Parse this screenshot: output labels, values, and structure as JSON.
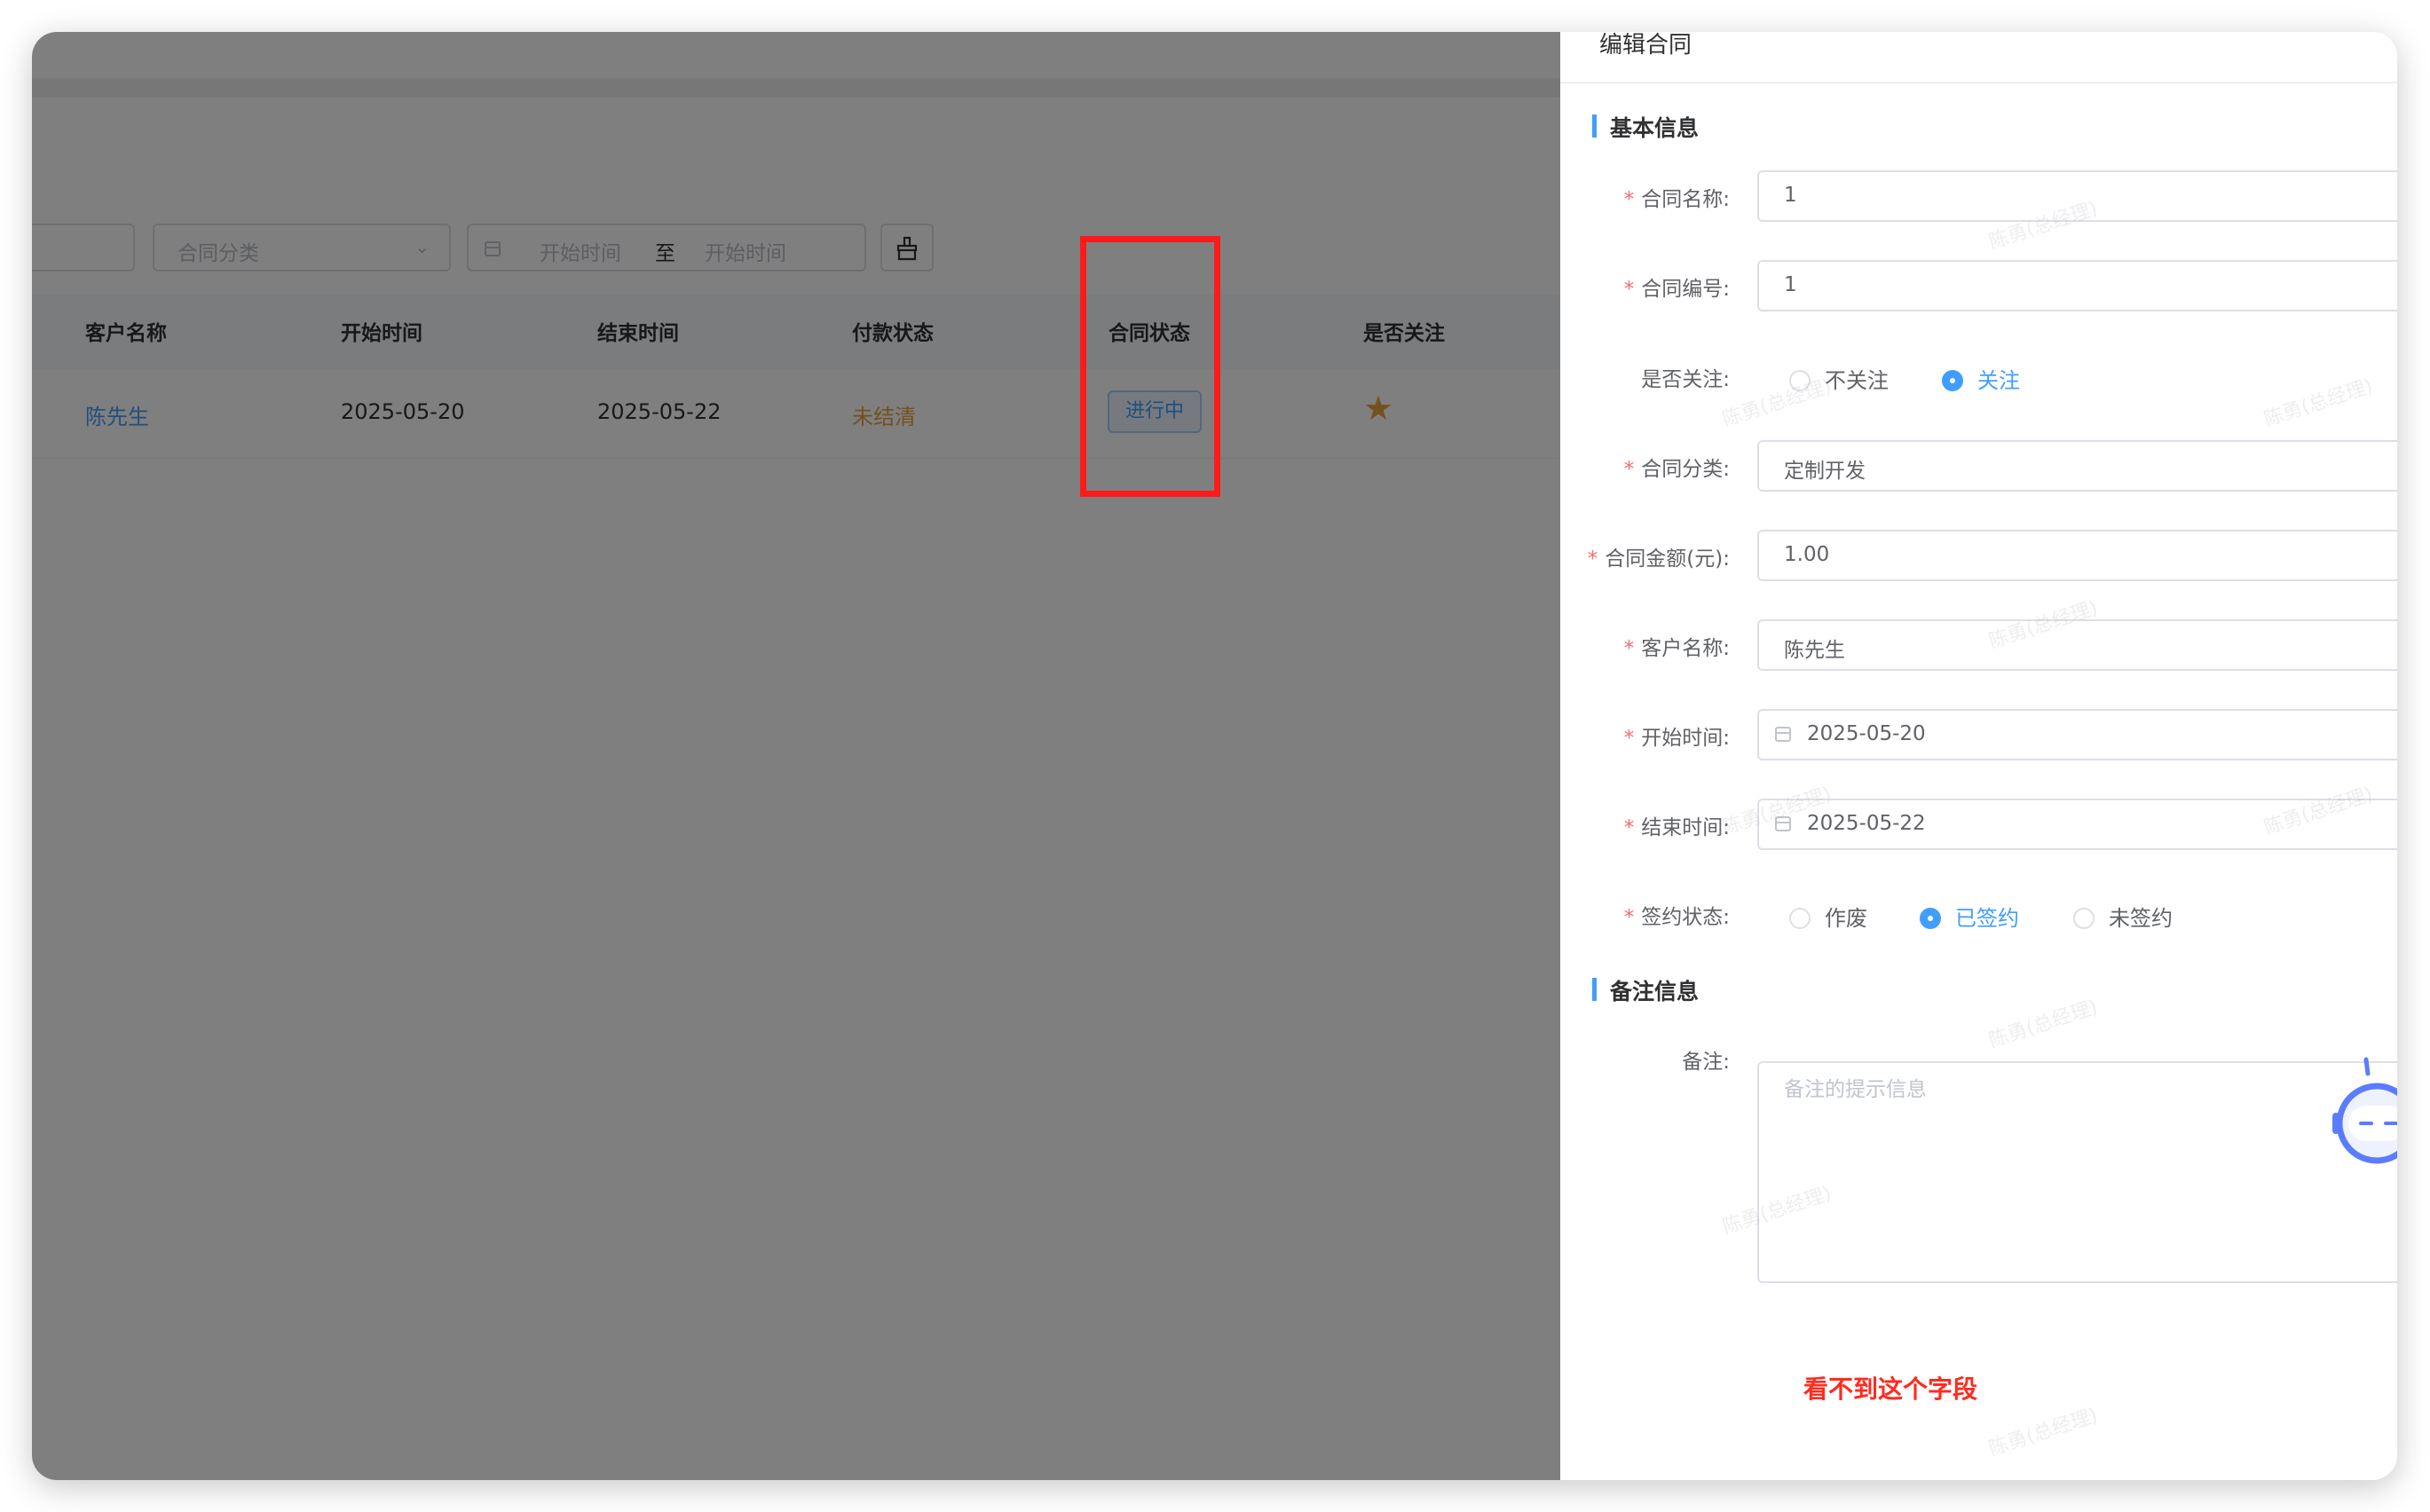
{
  "filters": {
    "category_placeholder": "合同分类",
    "start_placeholder": "开始时间",
    "range_separator": "至",
    "end_placeholder": "开始时间"
  },
  "table": {
    "columns": [
      "客户名称",
      "开始时间",
      "结束时间",
      "付款状态",
      "合同状态",
      "是否关注"
    ],
    "row": {
      "customer": "陈先生",
      "start": "2025-05-20",
      "end": "2025-05-22",
      "payment": "未结清",
      "status": "进行中",
      "followed": "★"
    }
  },
  "drawer": {
    "title": "编辑合同",
    "section_basic": "基本信息",
    "section_remark": "备注信息",
    "fields": {
      "name_label": "合同名称:",
      "name_value": "1",
      "number_label": "合同编号:",
      "number_value": "1",
      "follow_label": "是否关注:",
      "follow_options": [
        "不关注",
        "关注"
      ],
      "category_label": "合同分类:",
      "category_value": "定制开发",
      "amount_label": "合同金额(元):",
      "amount_value": "1.00",
      "customer_label": "客户名称:",
      "customer_value": "陈先生",
      "start_label": "开始时间:",
      "start_value": "2025-05-20",
      "end_label": "结束时间:",
      "end_value": "2025-05-22",
      "sign_label": "签约状态:",
      "sign_options": [
        "作废",
        "已签约",
        "未签约"
      ],
      "remark_label": "备注:",
      "remark_placeholder": "备注的提示信息"
    },
    "annotation": "看不到这个字段"
  },
  "watermark": "陈勇(总经理)",
  "colors": {
    "primary": "#409eff",
    "highlight": "#ff1a1a",
    "warning": "#e6a23c",
    "annotation": "#ff2b1f"
  }
}
